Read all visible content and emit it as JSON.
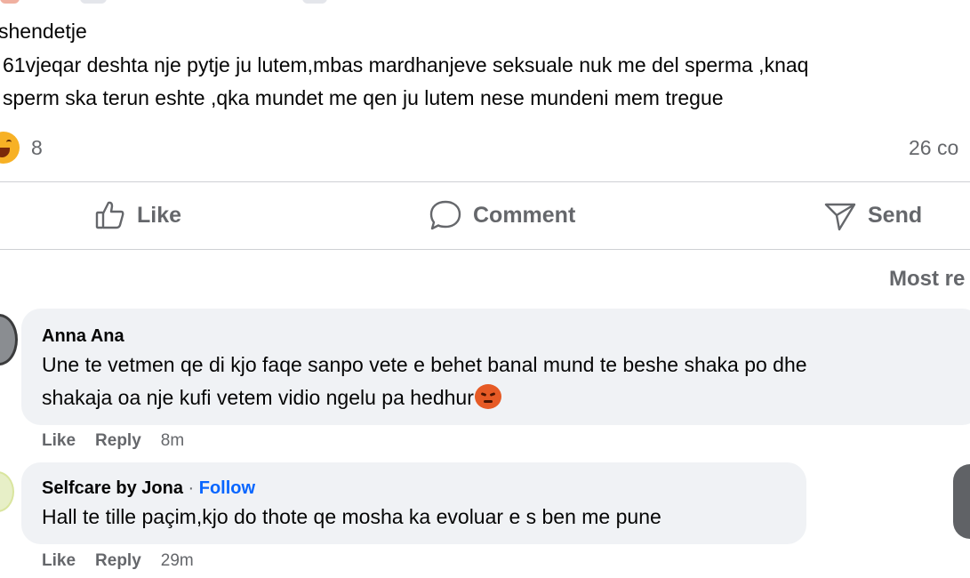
{
  "post": {
    "group_name": "shendetje",
    "body_line1": "61vjeqar deshta nje pytje ju lutem,mbas mardhanjeve seksuale nuk me del  sperma ,knaq",
    "body_line2": "sperm ska terun eshte ,qka mundet me qen ju lutem nese mundeni mem tregue",
    "reaction_count": "8",
    "comment_count": "26 co"
  },
  "actions": {
    "like_label": "Like",
    "comment_label": "Comment",
    "send_label": "Send"
  },
  "sort": {
    "label": "Most re"
  },
  "comments": [
    {
      "author": "Anna Ana",
      "text_line1": "Une te vetmen qe di kjo faqe sanpo vete e behet banal mund te beshe shaka po dhe",
      "text_line2": "shakaja oa nje kufi vetem vidio ngelu pa hedhur",
      "like_label": "Like",
      "reply_label": "Reply",
      "time": "8m"
    },
    {
      "author": "Selfcare by Jona",
      "separator": " · ",
      "follow_label": "Follow",
      "text_line1": "Hall te tille paçim,kjo do thote qe mosha ka evoluar e s ben me pune",
      "like_label": "Like",
      "reply_label": "Reply",
      "time": "29m"
    }
  ],
  "colors": {
    "accent": "#0866ff",
    "secondary_text": "#65676b",
    "bubble_bg": "#f0f2f5",
    "divider": "#ced0d4"
  }
}
